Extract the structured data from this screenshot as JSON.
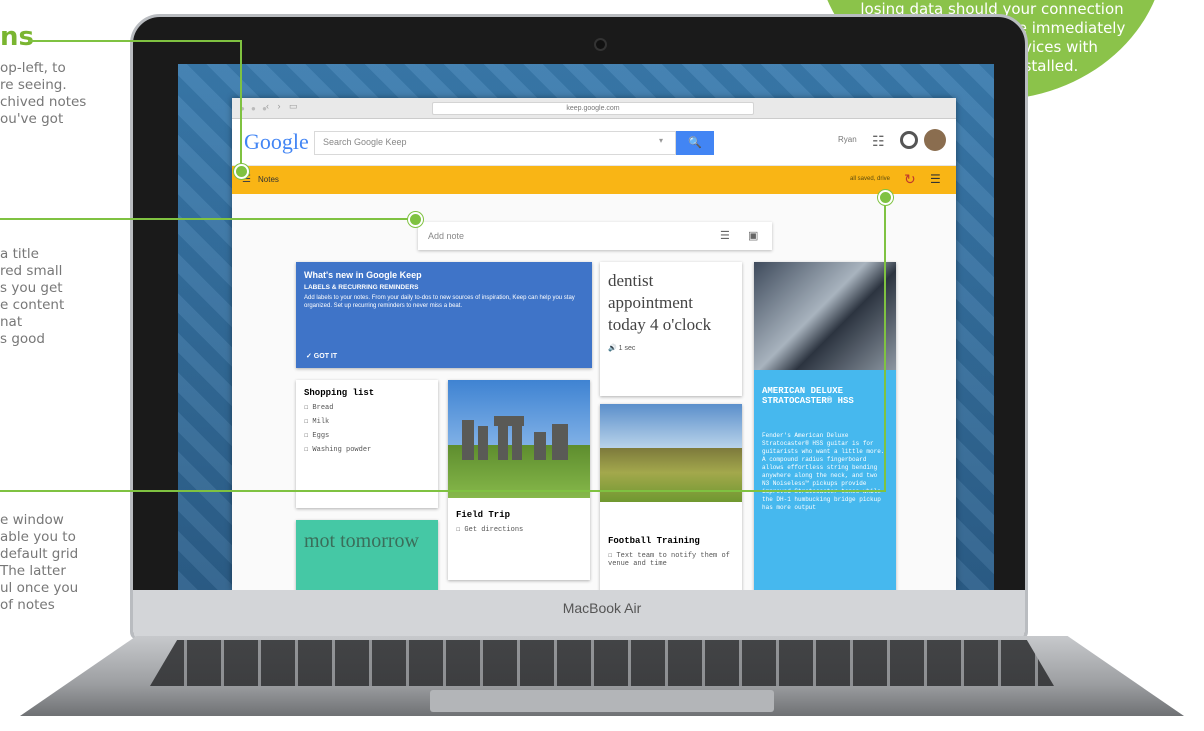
{
  "annotations": {
    "top": {
      "title": "ns",
      "lines": [
        "op-left, to",
        "re seeing.",
        "chived notes",
        "ou've got"
      ]
    },
    "middle": {
      "lines": [
        "a title",
        "red small",
        "s you get",
        "e content",
        "nat",
        "s good"
      ]
    },
    "bottom": {
      "lines": [
        "e window",
        "able you to",
        "default grid",
        "The latter",
        "ul once you",
        "of notes"
      ]
    }
  },
  "callout": {
    "lines": [
      "losing data should your connection",
      "drop. The changes are immediately",
      "available on all devices with",
      "the Keep app installed."
    ]
  },
  "laptop": {
    "brand": "MacBook Air"
  },
  "browser": {
    "url": "keep.google.com",
    "lights": "● ● ●",
    "nav": "‹ › ▭"
  },
  "keep": {
    "logo": "Google",
    "search_placeholder": "Search Google Keep",
    "search_dropdown": "▾",
    "search_icon": "🔍",
    "user": "Ryan",
    "apps_icon": "☷",
    "menu_icon": "☰",
    "section": "Notes",
    "saved": "all saved, drive",
    "refresh_icon": "↻",
    "list_view_icon": "☰",
    "add_note_placeholder": "Add note",
    "add_list_icon": "☰",
    "add_image_icon": "▣"
  },
  "cards": {
    "whats_new": {
      "title": "What's new in Google Keep",
      "subtitle": "LABELS & RECURRING REMINDERS",
      "body": "Add labels to your notes. From your daily to-dos to new sources of inspiration, Keep can help you stay organized. Set up recurring reminders to never miss a beat.",
      "action": "✓ GOT IT"
    },
    "dentist": {
      "text": "dentist appointment today 4 o'clock",
      "audio": "🔊 1 sec"
    },
    "shopping": {
      "title": "Shopping list",
      "items": [
        "Bread",
        "Milk",
        "Eggs",
        "Washing powder"
      ]
    },
    "field_trip": {
      "title": "Field Trip",
      "item": "Get directions"
    },
    "football": {
      "title": "Football Training",
      "item": "Text team to notify them of venue and time"
    },
    "mot": {
      "text": "mot tomorrow"
    },
    "guitar": {
      "title": "AMERICAN DELUXE STRATOCASTER® HSS",
      "body": "Fender's American Deluxe Stratocaster® HSS guitar is for guitarists who want a little more. A compound radius fingerboard allows effortless string bending anywhere along the neck, and two N3 Noiseless™ pickups provide improved Stratocaster tones while the DH-1 humbucking bridge pickup has more output"
    }
  }
}
